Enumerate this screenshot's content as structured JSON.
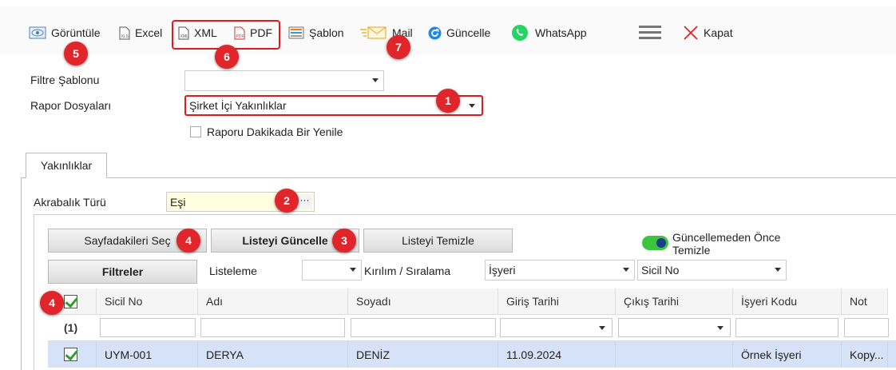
{
  "toolbar": {
    "view": "Görüntüle",
    "excel": "Excel",
    "xml": "XML",
    "pdf": "PDF",
    "template": "Şablon",
    "mail": "Mail",
    "refresh": "Güncelle",
    "whatsapp": "WhatsApp",
    "close": "Kapat"
  },
  "markers": {
    "m1": "1",
    "m2": "2",
    "m3": "3",
    "m4a": "4",
    "m4b": "4",
    "m5": "5",
    "m6": "6",
    "m7": "7"
  },
  "filters": {
    "template_label": "Filtre Şablonu",
    "template_value": "",
    "report_label": "Rapor Dosyaları",
    "report_value": "Şirket İçi Yakınlıklar",
    "auto_refresh_label": "Raporu Dakikada Bir Yenile"
  },
  "tab": {
    "label": "Yakınlıklar"
  },
  "panel": {
    "relation_label": "Akrabalık Türü",
    "relation_value": "Eşi",
    "select_page_button": "Sayfadakileri Seç",
    "update_list_button": "Listeyi Güncelle",
    "clear_list_button": "Listeyi Temizle",
    "clear_before_update_label": "Güncellemeden Önce Temizle",
    "filters_button": "Filtreler",
    "listing_label": "Listeleme",
    "listing_value": "",
    "breakdown_label": "Kırılım / Sıralama",
    "breakdown_1": "İşyeri",
    "breakdown_2": "Sicil No"
  },
  "grid": {
    "columns": [
      "Sicil No",
      "Adı",
      "Soyadı",
      "Giriş Tarihi",
      "Çıkış Tarihi",
      "İşyeri Kodu",
      "Not"
    ],
    "count_label": "(1)",
    "rows": [
      {
        "sicil": "UYM-001",
        "adi": "DERYA",
        "soyadi": "DENİZ",
        "giris": "11.09.2024",
        "cikis": "",
        "isyeri": "Örnek İşyeri",
        "not": "Kopy..."
      }
    ]
  },
  "colors": {
    "accent_red": "#e0252b",
    "toggle_on": "#3cc43c",
    "selected_row": "#d6e2f7"
  }
}
